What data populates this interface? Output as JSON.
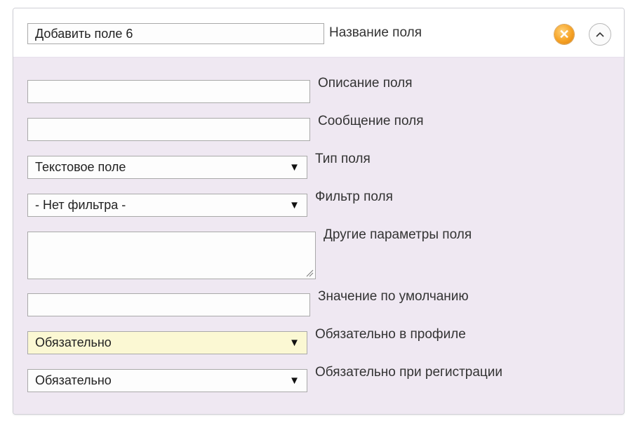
{
  "header": {
    "field_name_value": "Добавить поле 6",
    "field_name_label": "Название поля",
    "close_icon": "close-circle-icon",
    "collapse_icon": "chevron-up-icon"
  },
  "form": {
    "description": {
      "value": "",
      "label": "Описание поля"
    },
    "message": {
      "value": "",
      "label": "Сообщение поля"
    },
    "type": {
      "selected": "Текстовое поле",
      "label": "Тип поля"
    },
    "filter": {
      "selected": "- Нет фильтра -",
      "label": "Фильтр поля"
    },
    "other_params": {
      "value": "",
      "label": "Другие параметры поля"
    },
    "default_value": {
      "value": "",
      "label": "Значение по умолчанию"
    },
    "required_profile": {
      "selected": "Обязательно",
      "label": "Обязательно в профиле"
    },
    "required_registration": {
      "selected": "Обязательно",
      "label": "Обязательно при регистрации"
    }
  },
  "colors": {
    "body_bg": "#efe8f2",
    "highlight_select": "#fbf8d3",
    "close_button": "#f6a224"
  }
}
